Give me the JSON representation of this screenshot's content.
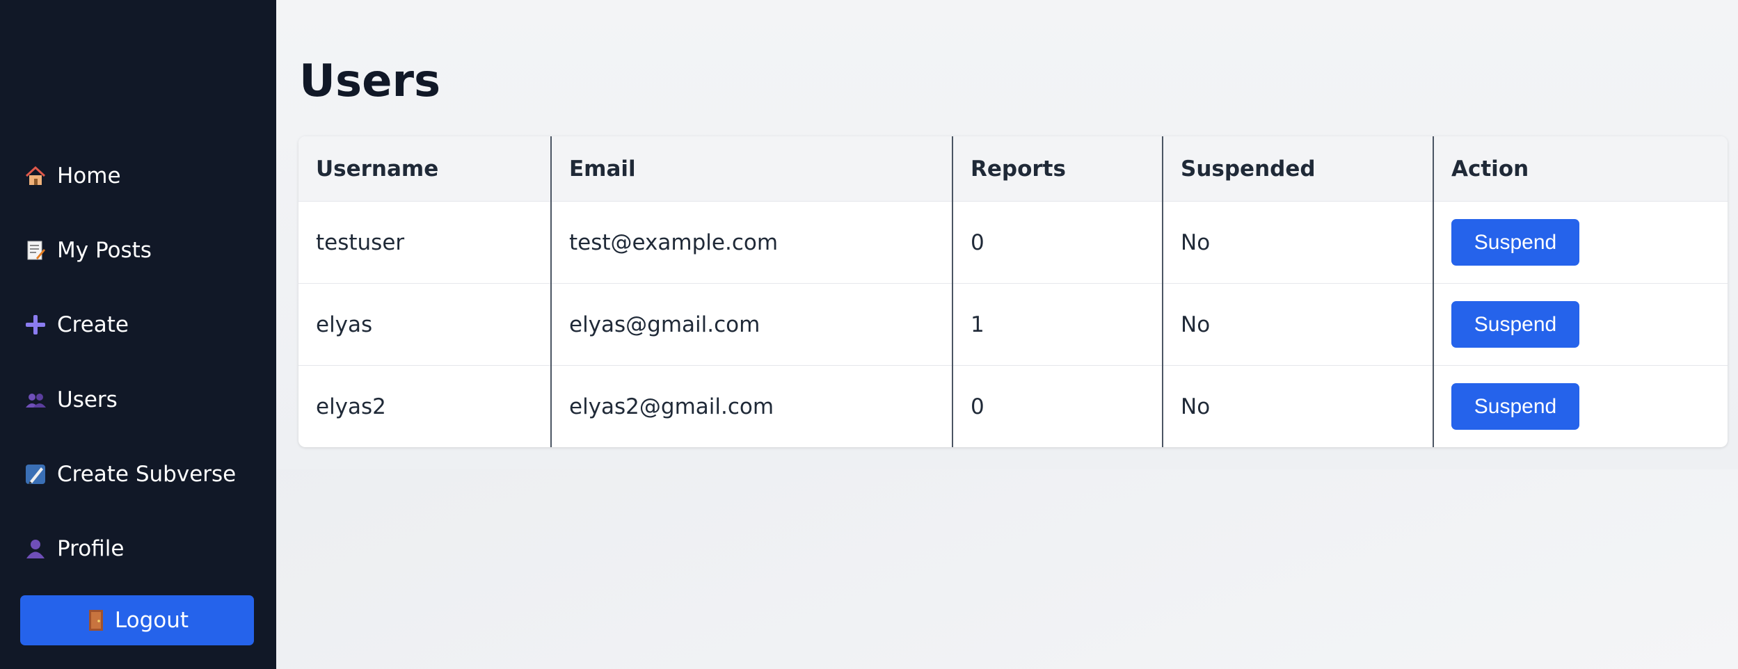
{
  "sidebar": {
    "items": [
      {
        "label": "Home",
        "icon": "house-icon"
      },
      {
        "label": "My Posts",
        "icon": "memo-icon"
      },
      {
        "label": "Create",
        "icon": "plus-icon"
      },
      {
        "label": "Users",
        "icon": "users-icon"
      },
      {
        "label": "Create Subverse",
        "icon": "pen-icon"
      },
      {
        "label": "Profile",
        "icon": "person-icon"
      }
    ],
    "logout_label": "Logout"
  },
  "page": {
    "title": "Users"
  },
  "table": {
    "headers": [
      "Username",
      "Email",
      "Reports",
      "Suspended",
      "Action"
    ],
    "rows": [
      {
        "username": "testuser",
        "email": "test@example.com",
        "reports": "0",
        "suspended": "No",
        "action": "Suspend"
      },
      {
        "username": "elyas",
        "email": "elyas@gmail.com",
        "reports": "1",
        "suspended": "No",
        "action": "Suspend"
      },
      {
        "username": "elyas2",
        "email": "elyas2@gmail.com",
        "reports": "0",
        "suspended": "No",
        "action": "Suspend"
      }
    ]
  },
  "colors": {
    "sidebar_bg": "#111827",
    "accent": "#2563eb",
    "text": "#1f2937"
  }
}
